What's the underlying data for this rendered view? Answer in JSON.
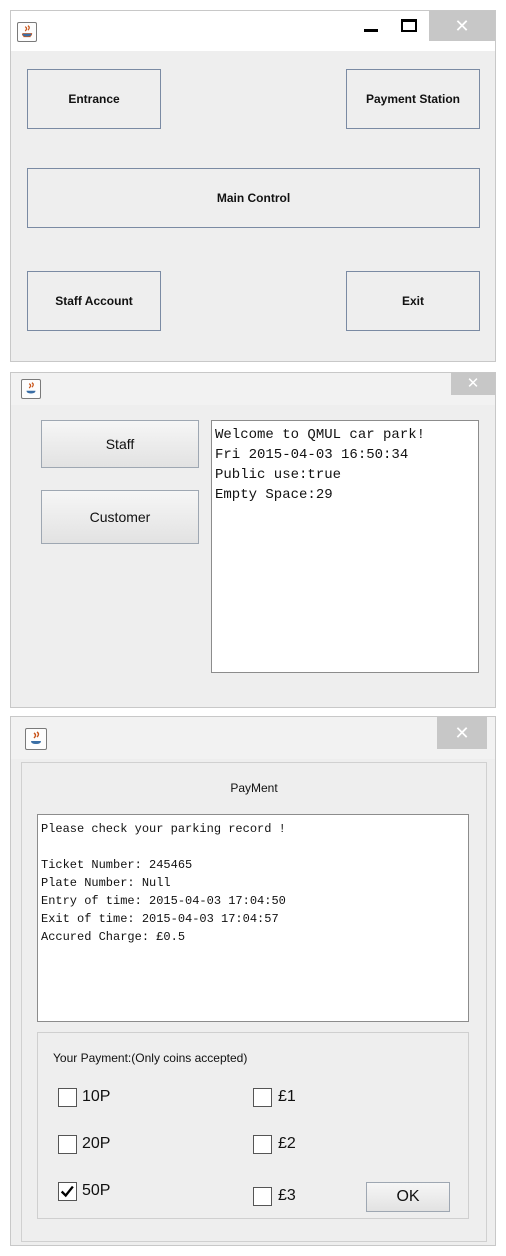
{
  "window1": {
    "entrance_label": "Entrance",
    "payment_station_label": "Payment Station",
    "main_control_label": "Main Control",
    "staff_account_label": "Staff Account",
    "exit_label": "Exit",
    "close_glyph": "✕"
  },
  "window2": {
    "staff_label": "Staff",
    "customer_label": "Customer",
    "info_lines": [
      "Welcome to QMUL car park!",
      "Fri 2015-04-03 16:50:34",
      "Public use:true",
      "Empty Space:29"
    ],
    "close_glyph": "✕"
  },
  "window3": {
    "title": "PayMent",
    "record_lines": [
      "Please check your parking record !",
      "",
      "Ticket Number: 245465",
      "Plate Number: Null",
      "Entry of time: 2015-04-03 17:04:50",
      "Exit of time: 2015-04-03 17:04:57",
      "Accured Charge: £0.5"
    ],
    "payment_heading": "Your Payment:(Only coins accepted)",
    "coins": [
      {
        "label": "10P",
        "checked": false
      },
      {
        "label": "20P",
        "checked": false
      },
      {
        "label": "50P",
        "checked": true
      },
      {
        "label": "£1",
        "checked": false
      },
      {
        "label": "£2",
        "checked": false
      },
      {
        "label": "£3",
        "checked": false
      }
    ],
    "ok_label": "OK",
    "close_glyph": "✕"
  },
  "colors": {
    "window_bg": "#eeeeee",
    "button_border": "#7a8aa3",
    "close_button": "#c7c7c7"
  }
}
